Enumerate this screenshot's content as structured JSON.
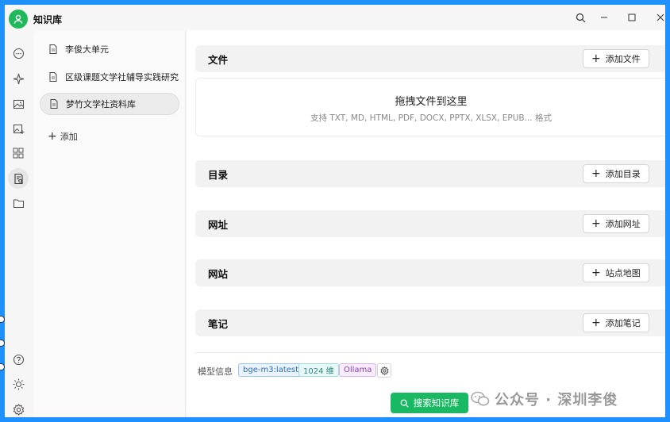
{
  "window": {
    "title": "知识库"
  },
  "knowledge_bases": [
    {
      "label": "李俊大单元"
    },
    {
      "label": "区级课题文学社辅导实践研究"
    },
    {
      "label": "梦竹文学社资料库"
    }
  ],
  "kb_add_label": "添加",
  "sections": {
    "files": {
      "title": "文件",
      "button": "添加文件"
    },
    "dropzone": {
      "title": "拖拽文件到这里",
      "subtitle": "支持 TXT, MD, HTML, PDF, DOCX, PPTX, XLSX, EPUB... 格式"
    },
    "directory": {
      "title": "目录",
      "button": "添加目录"
    },
    "url": {
      "title": "网址",
      "button": "添加网址"
    },
    "website": {
      "title": "网站",
      "button": "站点地图"
    },
    "notes": {
      "title": "笔记",
      "button": "添加笔记"
    }
  },
  "footer": {
    "model_label": "模型信息",
    "tags": [
      "bge-m3:latest",
      "1024 维",
      "Ollama"
    ],
    "search_button": "搜索知识库"
  },
  "watermark": "公众号 · 深圳李俊",
  "colors": {
    "accent": "#19b862",
    "background": "#1e90ff"
  },
  "icons": {
    "rail": [
      "chat-icon",
      "sparkle-icon",
      "image-icon",
      "image-plus-icon",
      "apps-grid-icon",
      "knowledge-icon",
      "folder-icon",
      "help-icon",
      "sun-icon",
      "settings-icon"
    ]
  }
}
